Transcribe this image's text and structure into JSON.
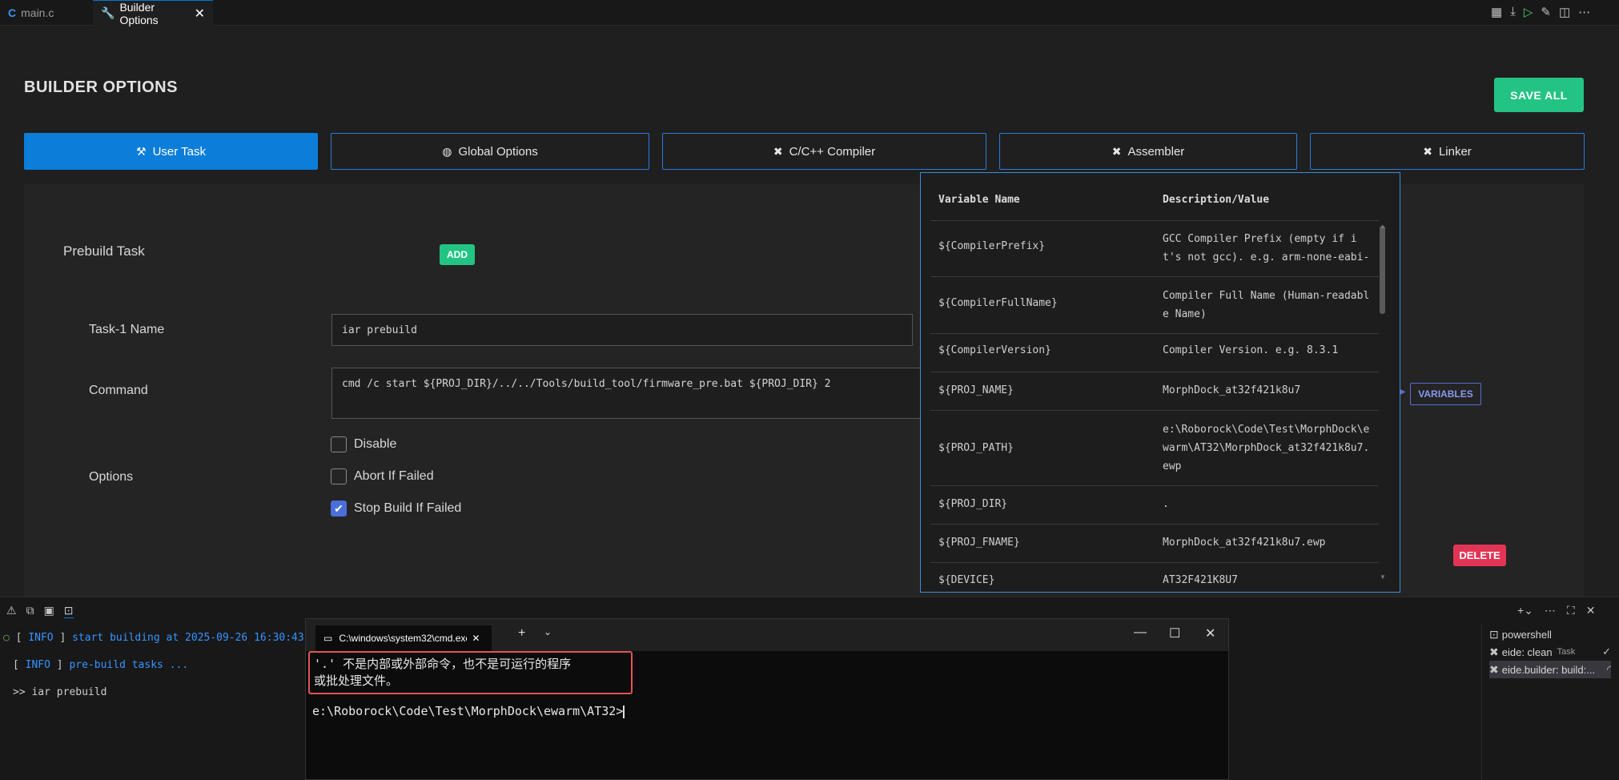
{
  "tabs": [
    {
      "label": "main.c",
      "icon": "c-file-icon"
    },
    {
      "label": "Builder Options",
      "icon": "wrench-icon"
    }
  ],
  "page_title": "BUILDER OPTIONS",
  "save_all": "SAVE ALL",
  "nav": [
    {
      "label": "User Task",
      "icon": "run-icon"
    },
    {
      "label": "Global Options",
      "icon": "globe-icon"
    },
    {
      "label": "C/C++ Compiler",
      "icon": "tools-icon"
    },
    {
      "label": "Assembler",
      "icon": "tools-icon"
    },
    {
      "label": "Linker",
      "icon": "tools-icon"
    }
  ],
  "prebuild": {
    "label": "Prebuild Task",
    "add": "ADD"
  },
  "task": {
    "name_label": "Task-1 Name",
    "name_value": "iar prebuild",
    "command_label": "Command",
    "command_value": "cmd /c start ${PROJ_DIR}/../../Tools/build_tool/firmware_pre.bat ${PROJ_DIR} 2",
    "options_label": "Options",
    "opt_disable": "Disable",
    "opt_abort": "Abort If Failed",
    "opt_stop": "Stop Build If Failed",
    "stop_checked": true
  },
  "variables_btn": "VARIABLES",
  "delete_btn": "DELETE",
  "vars": {
    "col_name": "Variable Name",
    "col_desc": "Description/Value",
    "rows": [
      {
        "name": "${CompilerPrefix}",
        "desc": "GCC Compiler Prefix (empty if i\nt's not gcc). e.g. arm-none-eabi-"
      },
      {
        "name": "${CompilerFullName}",
        "desc": "Compiler Full Name (Human-readabl\ne Name)"
      },
      {
        "name": "${CompilerVersion}",
        "desc": "Compiler Version. e.g. 8.3.1"
      },
      {
        "name": "${PROJ_NAME}",
        "desc": "MorphDock_at32f421k8u7"
      },
      {
        "name": "${PROJ_PATH}",
        "desc": "e:\\Roborock\\Code\\Test\\MorphDock\\e\nwarm\\AT32\\MorphDock_at32f421k8u7.\newp"
      },
      {
        "name": "${PROJ_DIR}",
        "desc": "."
      },
      {
        "name": "${PROJ_FNAME}",
        "desc": "MorphDock_at32f421k8u7.ewp"
      },
      {
        "name": "${DEVICE}",
        "desc": "AT32F421K8U7"
      }
    ]
  },
  "terminal": {
    "lines": [
      {
        "tag": "INFO",
        "text": "start building at 2025-09-26 16:30:43"
      },
      {
        "tag": "INFO",
        "text": "pre-build tasks ..."
      }
    ],
    "cmd_line": ">> iar prebuild"
  },
  "cmd": {
    "title": "C:\\windows\\system32\\cmd.exe",
    "error1": "'.' 不是内部或外部命令，也不是可运行的程序",
    "error2": "或批处理文件。",
    "prompt": "e:\\Roborock\\Code\\Test\\MorphDock\\ewarm\\AT32>"
  },
  "side": [
    {
      "label": "powershell"
    },
    {
      "label": "eide: clean",
      "suffix": "Task"
    },
    {
      "label": "eide.builder: build:..."
    }
  ]
}
